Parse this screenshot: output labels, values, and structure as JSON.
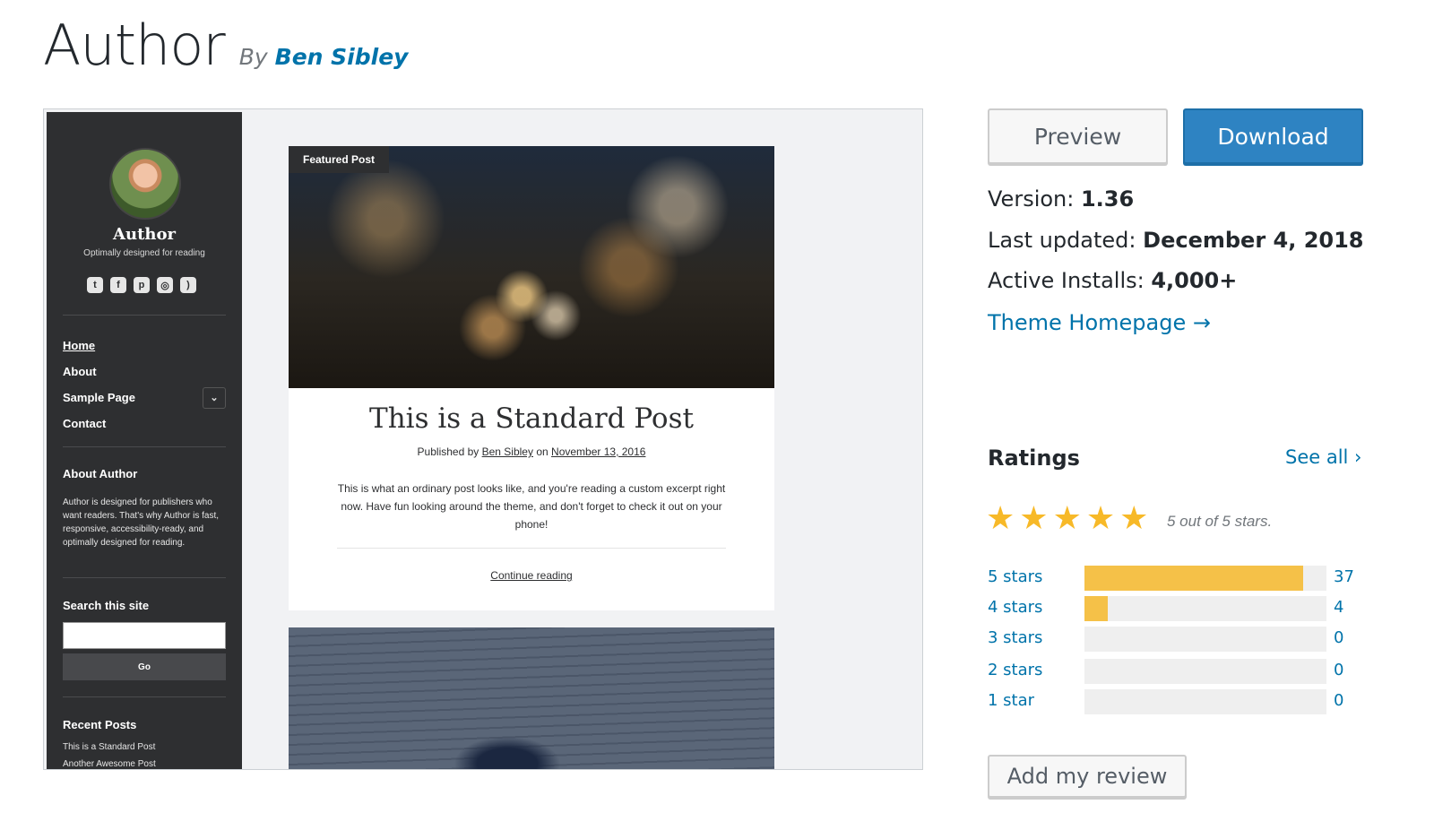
{
  "header": {
    "title": "Author",
    "by": "By",
    "author": "Ben Sibley"
  },
  "screenshot": {
    "sidebar": {
      "site_title": "Author",
      "tagline": "Optimally designed for reading",
      "social": [
        {
          "icon": "twitter-icon",
          "glyph": "t"
        },
        {
          "icon": "facebook-icon",
          "glyph": "f"
        },
        {
          "icon": "pinterest-icon",
          "glyph": "p"
        },
        {
          "icon": "instagram-icon",
          "glyph": "◎"
        },
        {
          "icon": "rss-icon",
          "glyph": ")"
        }
      ],
      "nav": [
        "Home",
        "About",
        "Sample Page",
        "Contact"
      ],
      "about_title": "About Author",
      "about_text": "Author is designed for publishers who want readers. That's why Author is fast, responsive, accessibility-ready, and optimally designed for reading.",
      "search_title": "Search this site",
      "search_button": "Go",
      "recent_title": "Recent Posts",
      "recent_posts": [
        "This is a Standard Post",
        "Another Awesome Post"
      ]
    },
    "post": {
      "tag": "Featured Post",
      "title": "This is a Standard Post",
      "meta_prefix": "Published by",
      "meta_author": "Ben Sibley",
      "meta_on": "on",
      "meta_date": "November 13, 2016",
      "excerpt": "This is what an ordinary post looks like, and you're reading a custom excerpt right now. Have fun looking around the theme, and don't forget to check it out on your phone!",
      "continue": "Continue reading"
    }
  },
  "actions": {
    "preview": "Preview",
    "download": "Download"
  },
  "meta": {
    "version_label": "Version:",
    "version": "1.36",
    "updated_label": "Last updated:",
    "updated": "December 4, 2018",
    "installs_label": "Active Installs:",
    "installs": "4,000+",
    "homepage": "Theme Homepage →"
  },
  "ratings": {
    "title": "Ratings",
    "see_all": "See all ›",
    "stars_caption": "5 out of 5 stars.",
    "stars_value": 5,
    "star_color": "#f7b928",
    "bar_color": "#f5c148",
    "rows": [
      {
        "label": "5 stars",
        "count": "37",
        "fraction": 0.902
      },
      {
        "label": "4 stars",
        "count": "4",
        "fraction": 0.098
      },
      {
        "label": "3 stars",
        "count": "0",
        "fraction": 0
      },
      {
        "label": "2 stars",
        "count": "0",
        "fraction": 0
      },
      {
        "label": "1 star",
        "count": "0",
        "fraction": 0
      }
    ],
    "add_review": "Add my review"
  },
  "colors": {
    "link": "#0073aa",
    "download_bg": "#2e83c2",
    "mock_sidebar_bg": "#2e2f31"
  }
}
